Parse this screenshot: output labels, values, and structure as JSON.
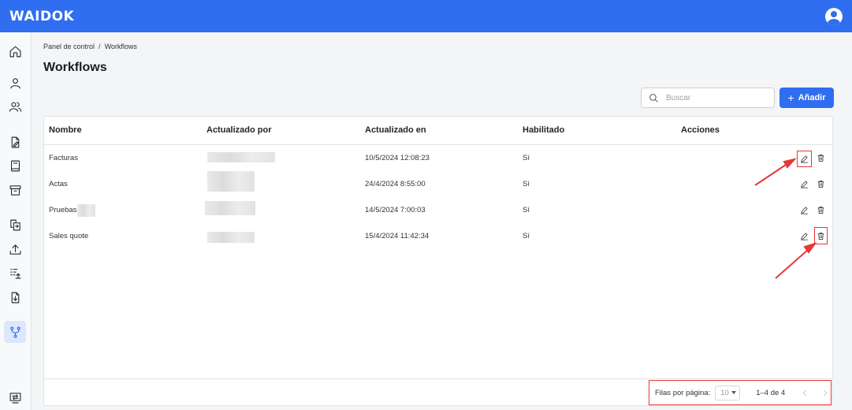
{
  "header": {
    "logo": "WAIDOK",
    "user_icon": "account-circle-icon",
    "brand_color": "#2f6ef0"
  },
  "sidebar": {
    "items": [
      {
        "name": "home",
        "icon": "home-icon"
      },
      {
        "name": "user",
        "icon": "user-icon"
      },
      {
        "name": "users",
        "icon": "users-icon"
      },
      {
        "name": "document-edit",
        "icon": "document-edit-icon"
      },
      {
        "name": "book",
        "icon": "book-icon"
      },
      {
        "name": "archive",
        "icon": "archive-icon"
      },
      {
        "name": "copy-documents",
        "icon": "copy-documents-icon"
      },
      {
        "name": "upload",
        "icon": "upload-icon"
      },
      {
        "name": "list-upload",
        "icon": "list-upload-icon"
      },
      {
        "name": "file-download",
        "icon": "file-download-icon"
      },
      {
        "name": "workflows",
        "icon": "workflow-icon",
        "active": true
      },
      {
        "name": "switch-account",
        "icon": "switch-account-icon"
      }
    ]
  },
  "breadcrumb": {
    "parent": "Panel de control",
    "separator": "/",
    "current": "Workflows"
  },
  "page": {
    "title": "Workflows"
  },
  "search": {
    "placeholder": "Buscar",
    "value": ""
  },
  "add_button": {
    "label": "Añadir"
  },
  "table": {
    "columns": [
      "Nombre",
      "Actualizado por",
      "Actualizado en",
      "Habilitado",
      "Acciones"
    ],
    "rows": [
      {
        "name": "Facturas",
        "updated_at": "10/5/2024 12:08:23",
        "enabled": "Sí"
      },
      {
        "name": "Actas",
        "updated_at": "24/4/2024 8:55:00",
        "enabled": "Sí"
      },
      {
        "name": "Pruebas",
        "updated_at": "14/5/2024 7:00:03",
        "enabled": "Sí"
      },
      {
        "name": "Sales quote",
        "updated_at": "15/4/2024 11:42:34",
        "enabled": "Sí"
      }
    ]
  },
  "pagination": {
    "rows_per_page_label": "Filas por página:",
    "rows_per_page": "10",
    "range": "1–4 de 4"
  },
  "annotation_color": "#e53935"
}
